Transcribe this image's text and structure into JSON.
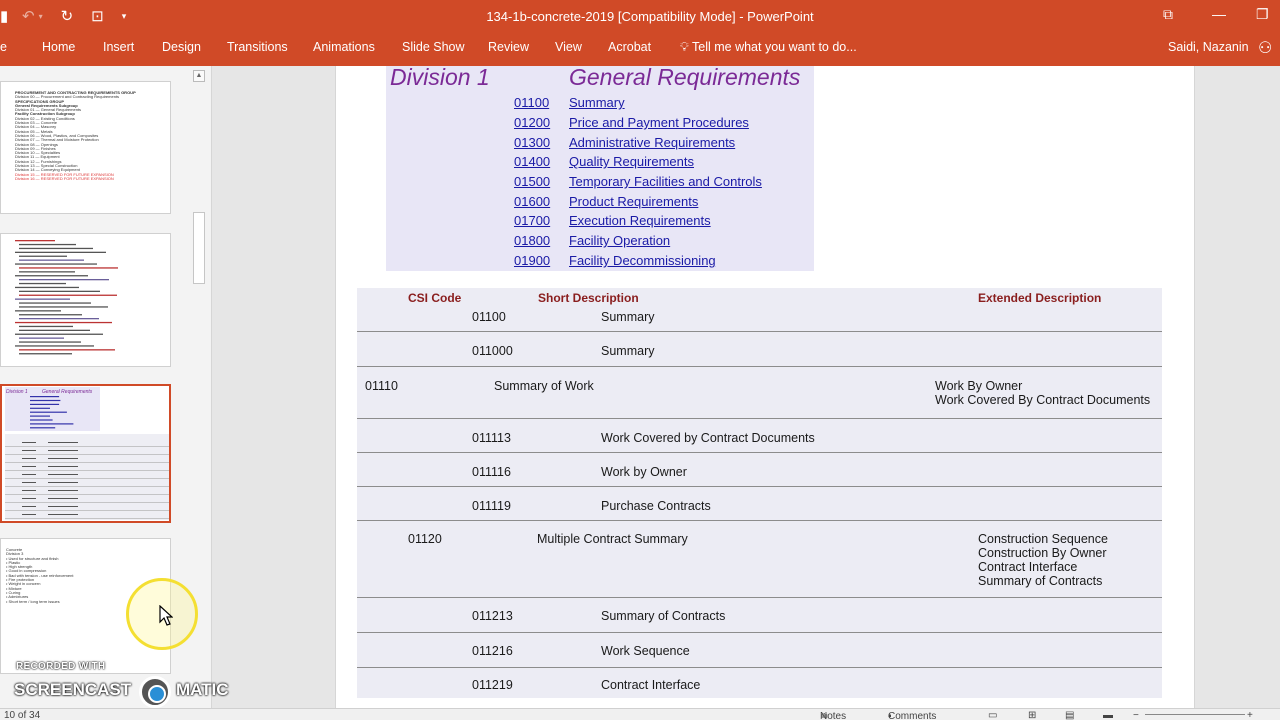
{
  "window": {
    "title": "134-1b-concrete-2019 [Compatibility Mode] - PowerPoint"
  },
  "ribbon": {
    "tabs": [
      "Home",
      "Insert",
      "Design",
      "Transitions",
      "Animations",
      "Slide Show",
      "Review",
      "View",
      "Acrobat"
    ],
    "tell_me": "Tell me what you want to do...",
    "user": "Saidi, Nazanin"
  },
  "thumbnails": {
    "thumb1_lines": [
      "PROCUREMENT AND CONTRACTING REQUIREMENTS GROUP",
      "Division 00 — Procurement and Contracting Requirements",
      "SPECIFICATIONS GROUP",
      "General Requirements Subgroup",
      "Division 01 — General Requirements",
      "Facility Construction Subgroup",
      "Division 02 — Existing Conditions",
      "Division 03 — Concrete",
      "Division 04 — Masonry",
      "Division 05 — Metals",
      "Division 06 — Wood, Plastics, and Composites",
      "Division 07 — Thermal and Moisture Protection",
      "Division 08 — Openings",
      "Division 09 — Finishes",
      "Division 10 — Specialties",
      "Division 11 — Equipment",
      "Division 12 — Furnishings",
      "Division 13 — Special Construction",
      "Division 14 — Conveying Equipment",
      "Division 15 — RESERVED FOR FUTURE EXPANSION",
      "Division 16 — RESERVED FOR FUTURE EXPANSION"
    ],
    "thumb4_lines": [
      "Concrete",
      "Division 3",
      "• Used for structure and finish",
      "• Plastic",
      "• High strength",
      "    • Good in compression",
      "    • Bad with tension - use reinforcement",
      "• Fire protection",
      "• Weight in concern",
      "",
      "• Mixture",
      "• Curing",
      "• Admixtures",
      "• Short term / long term issues"
    ]
  },
  "slide": {
    "division": "Division 1",
    "division_title": "General Requirements",
    "sections": [
      {
        "code": "01100",
        "desc": "Summary"
      },
      {
        "code": "01200",
        "desc": "Price and Payment Procedures"
      },
      {
        "code": "01300",
        "desc": "Administrative Requirements"
      },
      {
        "code": "01400",
        "desc": "Quality Requirements"
      },
      {
        "code": "01500",
        "desc": "Temporary Facilities and Controls"
      },
      {
        "code": "01600",
        "desc": "Product Requirements"
      },
      {
        "code": "01700",
        "desc": "Execution Requirements"
      },
      {
        "code": "01800",
        "desc": "Facility Operation"
      },
      {
        "code": "01900",
        "desc": "Facility Decommissioning"
      }
    ],
    "table": {
      "headers": {
        "code": "CSI Code",
        "short": "Short Description",
        "extended": "Extended Description"
      },
      "rows": [
        {
          "code": "01100",
          "short": "Summary",
          "ext": ""
        },
        {
          "code": "011000",
          "short": "Summary",
          "ext": ""
        },
        {
          "code": "01110",
          "short": "Summary of Work",
          "ext": "Work By Owner\nWork Covered By Contract Documents"
        },
        {
          "code": "011113",
          "short": "Work Covered by Contract Documents",
          "ext": ""
        },
        {
          "code": "011116",
          "short": "Work by Owner",
          "ext": ""
        },
        {
          "code": "011119",
          "short": "Purchase Contracts",
          "ext": ""
        },
        {
          "code": "01120",
          "short": "Multiple Contract Summary",
          "ext": "Construction Sequence\nConstruction By Owner\nContract Interface\nSummary of Contracts"
        },
        {
          "code": "011213",
          "short": "Summary of Contracts",
          "ext": ""
        },
        {
          "code": "011216",
          "short": "Work Sequence",
          "ext": ""
        },
        {
          "code": "011219",
          "short": "Contract Interface",
          "ext": ""
        }
      ]
    }
  },
  "statusbar": {
    "slide_counter": "10 of 34",
    "notes": "Notes",
    "comments": "Comments"
  },
  "watermark": {
    "recorded": "RECORDED WITH",
    "brand_left": "SCREENCAST",
    "brand_right": "MATIC"
  },
  "colors": {
    "accent": "#d04a27",
    "division_text": "#7b2a96",
    "link": "#1a1aa6",
    "table_header": "#8a1e1e"
  }
}
